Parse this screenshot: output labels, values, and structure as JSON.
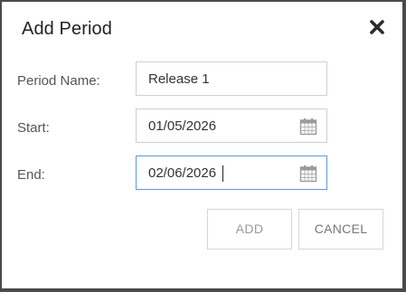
{
  "dialog": {
    "title": "Add Period",
    "close_icon": "close-icon"
  },
  "form": {
    "period_name": {
      "label": "Period Name:",
      "value": "Release 1"
    },
    "start": {
      "label": "Start:",
      "value": "01/05/2026",
      "icon": "calendar-icon"
    },
    "end": {
      "label": "End:",
      "value": "02/06/2026",
      "icon": "calendar-icon",
      "focused": true
    }
  },
  "buttons": {
    "add_label": "ADD",
    "cancel_label": "CANCEL"
  },
  "colors": {
    "backdrop": "#4a4a4a",
    "focus_border": "#5b9bd5",
    "border": "#cfcfcf"
  }
}
